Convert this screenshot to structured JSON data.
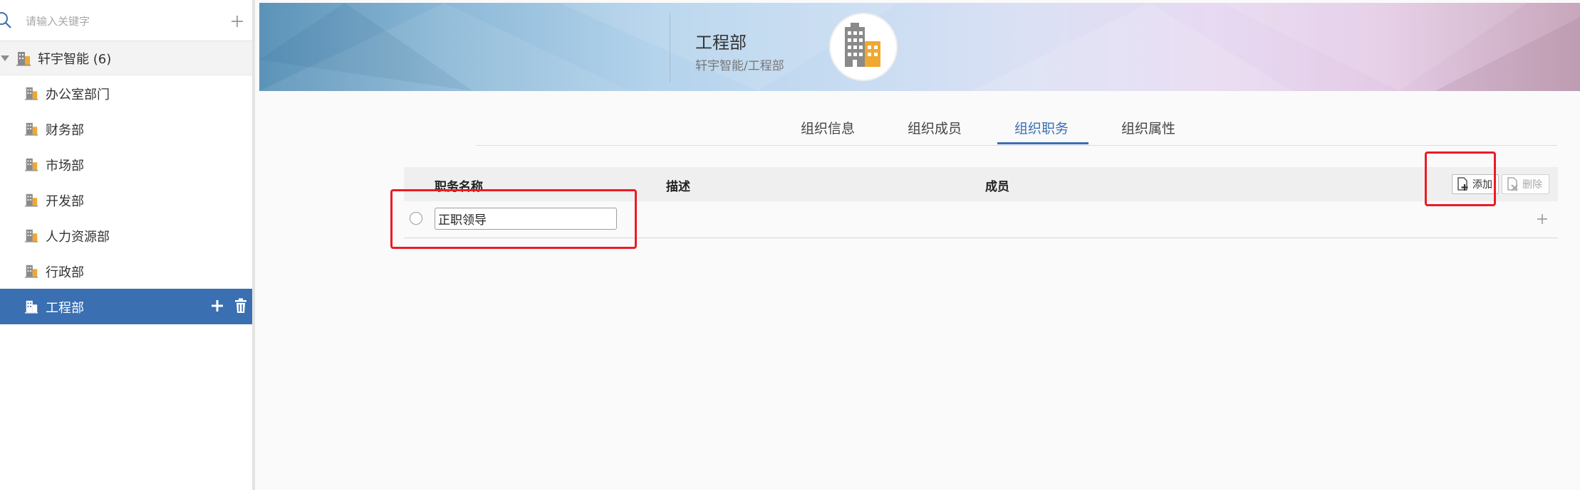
{
  "sidebar": {
    "search": {
      "placeholder": "请输入关键字"
    },
    "tree": {
      "root": {
        "label": "轩宇智能 (6)"
      },
      "items": [
        {
          "label": "办公室部门"
        },
        {
          "label": "财务部"
        },
        {
          "label": "市场部"
        },
        {
          "label": "开发部"
        },
        {
          "label": "人力资源部"
        },
        {
          "label": "行政部"
        },
        {
          "label": "工程部",
          "selected": true
        }
      ]
    }
  },
  "banner": {
    "title": "工程部",
    "path": "轩宇智能/工程部",
    "logo_icon": "building-icon"
  },
  "tabs": [
    {
      "label": "组织信息"
    },
    {
      "label": "组织成员"
    },
    {
      "label": "组织职务",
      "active": true
    },
    {
      "label": "组织属性"
    }
  ],
  "table": {
    "columns": [
      "职务名称",
      "描述",
      "成员"
    ],
    "add_label": "添加",
    "delete_label": "删除",
    "rows": [
      {
        "name_value": "正职领导"
      }
    ]
  },
  "colors": {
    "accent": "#3a6fb1",
    "highlight": "#ec1c24",
    "building_gray": "#8a8a8a",
    "building_orange": "#f0a830"
  }
}
